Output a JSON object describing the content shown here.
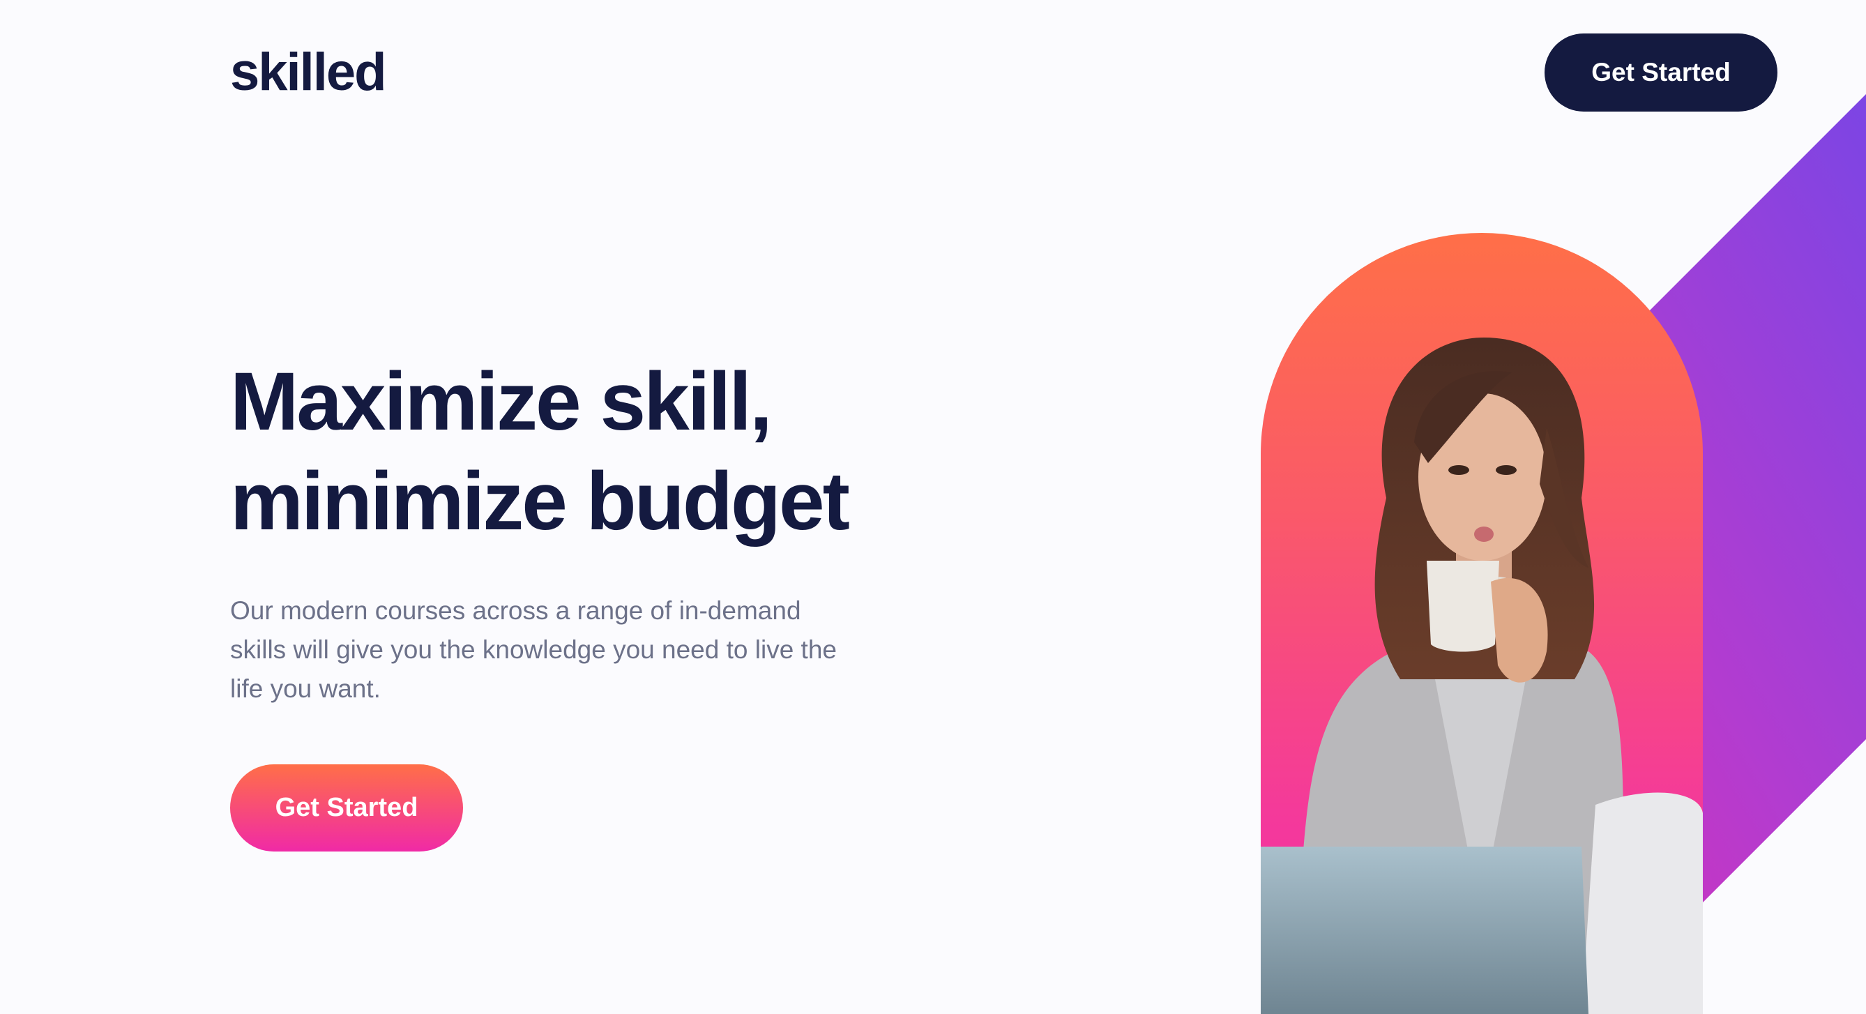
{
  "header": {
    "logo": "skilled",
    "cta_label": "Get Started"
  },
  "hero": {
    "headline_line1": "Maximize skill,",
    "headline_line2": "minimize budget",
    "description": "Our modern courses across a range of in-demand skills will give you the knowledge you need to live the life you want.",
    "cta_label": "Get Started"
  },
  "colors": {
    "navy": "#141a40",
    "gradient_orange": "#ff6f48",
    "gradient_pink": "#f02aa6",
    "gradient_purple": "#8a3ce0",
    "body_text": "#6c7189",
    "background": "#fbfbfe"
  }
}
